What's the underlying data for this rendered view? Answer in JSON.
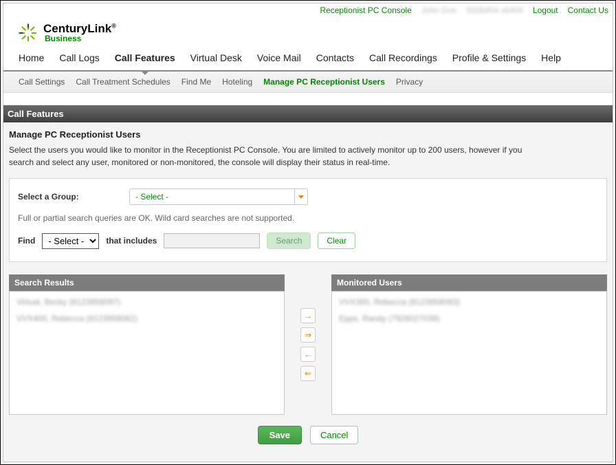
{
  "top_links": {
    "console": "Receptionist PC Console",
    "user": "John Doe",
    "ext": "5556404 x6404",
    "logout": "Logout",
    "contact": "Contact Us"
  },
  "brand": {
    "line1": "CenturyLink",
    "reg": "®",
    "line2": "Business"
  },
  "main_nav": [
    {
      "label": "Home"
    },
    {
      "label": "Call Logs"
    },
    {
      "label": "Call Features",
      "active": true
    },
    {
      "label": "Virtual Desk"
    },
    {
      "label": "Voice Mail"
    },
    {
      "label": "Contacts"
    },
    {
      "label": "Call Recordings"
    },
    {
      "label": "Profile & Settings"
    },
    {
      "label": "Help"
    }
  ],
  "sub_nav": [
    {
      "label": "Call Settings"
    },
    {
      "label": "Call Treatment Schedules"
    },
    {
      "label": "Find Me"
    },
    {
      "label": "Hoteling"
    },
    {
      "label": "Manage PC Receptionist Users",
      "active": true
    },
    {
      "label": "Privacy"
    }
  ],
  "section_bar": "Call Features",
  "page": {
    "title": "Manage PC Receptionist Users",
    "desc": "Select the users you would like to monitor in the Receptionist PC Console. You are limited to actively monitor up to 200 users, however if you search and select any user, monitored or non-monitored, the console will display their status in real-time."
  },
  "group": {
    "label": "Select a Group:",
    "value": "- Select -"
  },
  "search_hint": "Full or partial search queries are OK. Wild card searches are not supported.",
  "find": {
    "label": "Find",
    "select": "- Select -",
    "that": "that includes",
    "search_btn": "Search",
    "clear_btn": "Clear",
    "input_value": ""
  },
  "dual": {
    "left_header": "Search Results",
    "right_header": "Monitored Users",
    "left_items": [
      "Virtual, Becky (8123958097)",
      "VVX400, Rebecca (8123958062)"
    ],
    "right_items": [
      "VVX300, Rebecca (8123958083)",
      "Epps, Randy (7928027038)"
    ],
    "arrows": {
      "add": "→",
      "add_all": "⇒",
      "remove": "←",
      "remove_all": "⇐"
    }
  },
  "footer": {
    "save": "Save",
    "cancel": "Cancel"
  }
}
